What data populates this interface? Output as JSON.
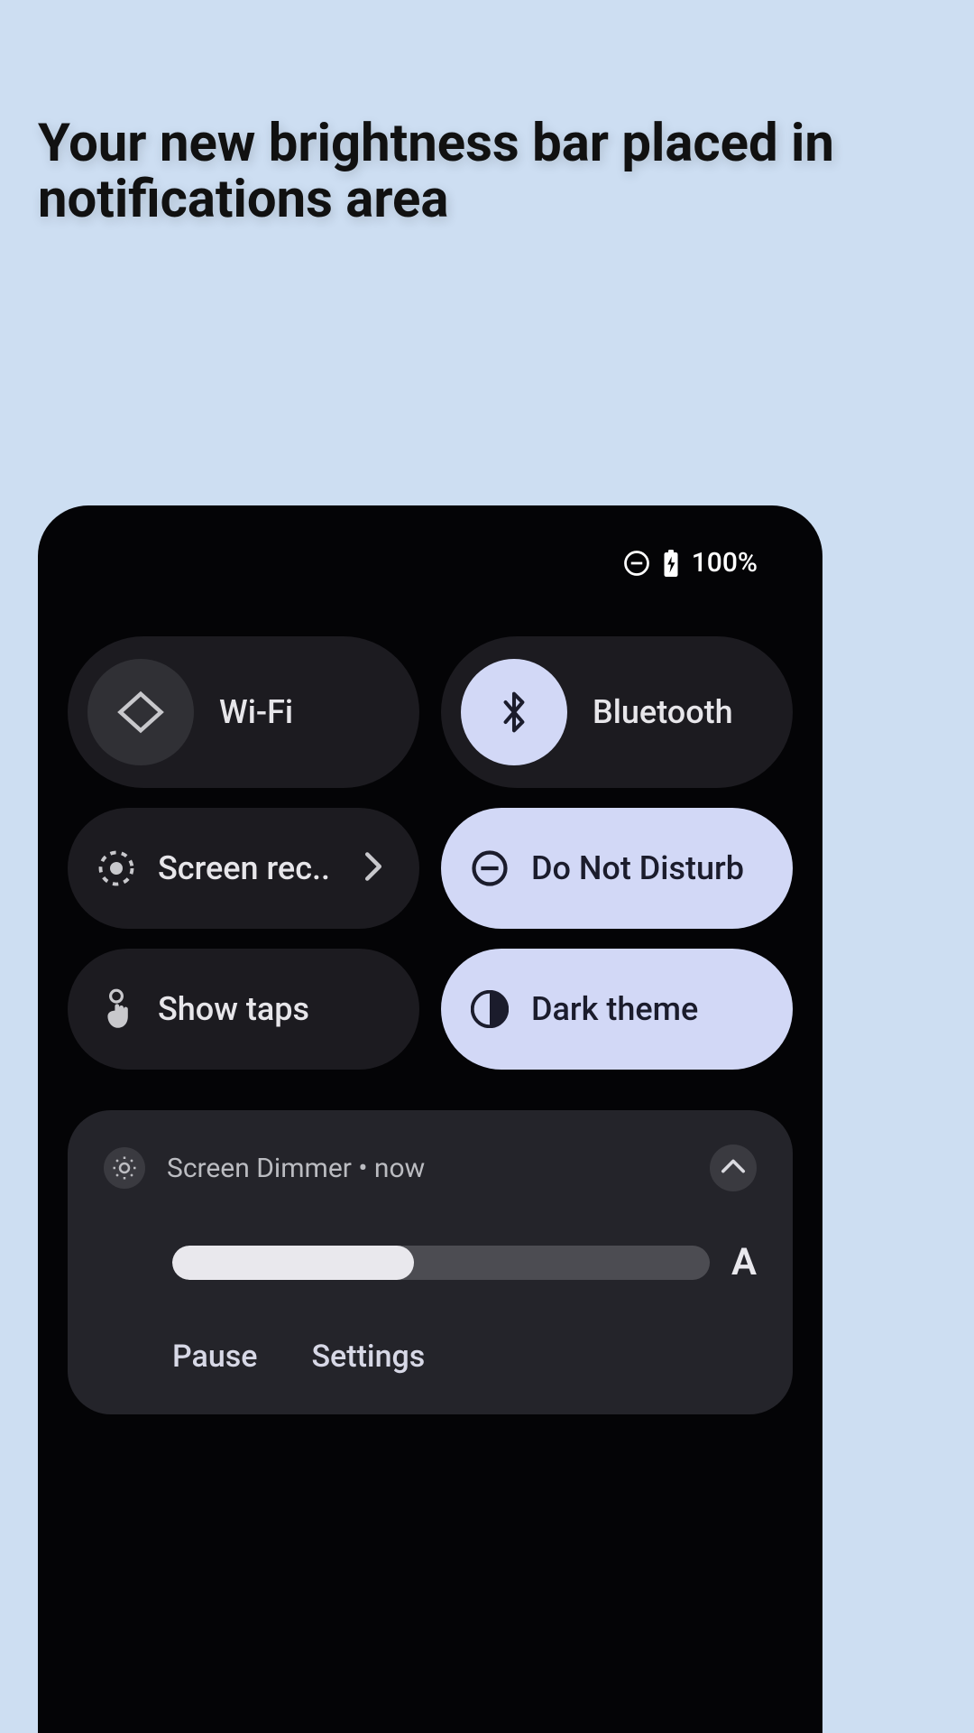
{
  "headline": "Your new brightness bar placed in notifications area",
  "status": {
    "battery_percent": "100%"
  },
  "tiles": {
    "wifi": {
      "label": "Wi-Fi",
      "active": false
    },
    "bt": {
      "label": "Bluetooth",
      "active": true
    },
    "rec": {
      "label": "Screen rec..",
      "active": false
    },
    "dnd": {
      "label": "Do Not Disturb",
      "active": true
    },
    "taps": {
      "label": "Show taps",
      "active": false
    },
    "dark": {
      "label": "Dark theme",
      "active": true
    }
  },
  "notification": {
    "app": "Screen Dimmer",
    "sep": " • ",
    "when": "now",
    "slider_percent": 45,
    "suffix_label": "A",
    "actions": {
      "pause": "Pause",
      "settings": "Settings"
    }
  }
}
